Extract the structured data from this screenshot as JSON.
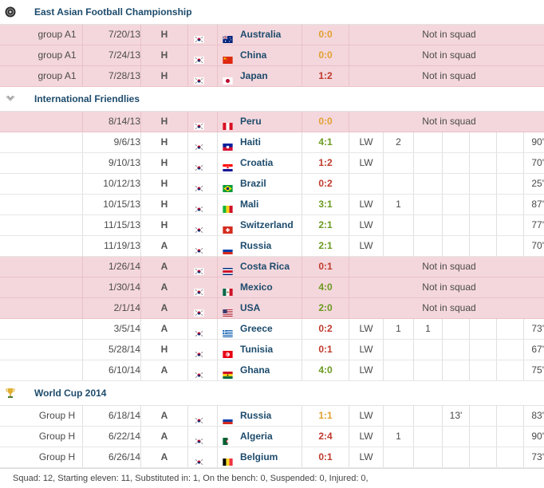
{
  "sections": [
    {
      "title": "East Asian Football Championship",
      "icon": "eaff-logo-icon",
      "rows": [
        {
          "round": "group A1",
          "date": "7/20/13",
          "ha": "H",
          "opp": "Australia",
          "opp_flag": "australia",
          "result": "0:0",
          "res_color": "o",
          "status": "Not in squad"
        },
        {
          "round": "group A1",
          "date": "7/24/13",
          "ha": "H",
          "opp": "China",
          "opp_flag": "china",
          "result": "0:0",
          "res_color": "o",
          "status": "Not in squad"
        },
        {
          "round": "group A1",
          "date": "7/28/13",
          "ha": "H",
          "opp": "Japan",
          "opp_flag": "japan",
          "result": "1:2",
          "res_color": "r",
          "status": "Not in squad"
        }
      ]
    },
    {
      "title": "International Friendlies",
      "icon": "wings-icon",
      "rows": [
        {
          "round": "",
          "date": "8/14/13",
          "ha": "H",
          "opp": "Peru",
          "opp_flag": "peru",
          "result": "0:0",
          "res_color": "o",
          "status": "Not in squad"
        },
        {
          "round": "",
          "date": "9/6/13",
          "ha": "H",
          "opp": "Haiti",
          "opp_flag": "haiti",
          "result": "4:1",
          "res_color": "g",
          "pos": "LW",
          "goals": "2",
          "assists": "",
          "yellow": "",
          "minutes": "90'"
        },
        {
          "round": "",
          "date": "9/10/13",
          "ha": "H",
          "opp": "Croatia",
          "opp_flag": "croatia",
          "result": "1:2",
          "res_color": "r",
          "pos": "LW",
          "goals": "",
          "assists": "",
          "yellow": "",
          "minutes": "70'"
        },
        {
          "round": "",
          "date": "10/12/13",
          "ha": "H",
          "opp": "Brazil",
          "opp_flag": "brazil",
          "result": "0:2",
          "res_color": "r",
          "pos": "",
          "goals": "",
          "assists": "",
          "yellow": "",
          "minutes": "25'"
        },
        {
          "round": "",
          "date": "10/15/13",
          "ha": "H",
          "opp": "Mali",
          "opp_flag": "mali",
          "result": "3:1",
          "res_color": "g",
          "pos": "LW",
          "goals": "1",
          "assists": "",
          "yellow": "",
          "minutes": "87'"
        },
        {
          "round": "",
          "date": "11/15/13",
          "ha": "H",
          "opp": "Switzerland",
          "opp_flag": "switzerland",
          "result": "2:1",
          "res_color": "g",
          "pos": "LW",
          "goals": "",
          "assists": "",
          "yellow": "",
          "minutes": "77'"
        },
        {
          "round": "",
          "date": "11/19/13",
          "ha": "A",
          "opp": "Russia",
          "opp_flag": "russia",
          "result": "2:1",
          "res_color": "g",
          "pos": "LW",
          "goals": "",
          "assists": "",
          "yellow": "",
          "minutes": "70'"
        },
        {
          "round": "",
          "date": "1/26/14",
          "ha": "A",
          "opp": "Costa Rica",
          "opp_flag": "costarica",
          "result": "0:1",
          "res_color": "r",
          "status": "Not in squad"
        },
        {
          "round": "",
          "date": "1/30/14",
          "ha": "A",
          "opp": "Mexico",
          "opp_flag": "mexico",
          "result": "4:0",
          "res_color": "g",
          "status": "Not in squad"
        },
        {
          "round": "",
          "date": "2/1/14",
          "ha": "A",
          "opp": "USA",
          "opp_flag": "usa",
          "result": "2:0",
          "res_color": "g",
          "status": "Not in squad"
        },
        {
          "round": "",
          "date": "3/5/14",
          "ha": "A",
          "opp": "Greece",
          "opp_flag": "greece",
          "result": "0:2",
          "res_color": "r",
          "pos": "LW",
          "goals": "1",
          "assists": "1",
          "yellow": "",
          "minutes": "73'"
        },
        {
          "round": "",
          "date": "5/28/14",
          "ha": "H",
          "opp": "Tunisia",
          "opp_flag": "tunisia",
          "result": "0:1",
          "res_color": "r",
          "pos": "LW",
          "goals": "",
          "assists": "",
          "yellow": "",
          "minutes": "67'"
        },
        {
          "round": "",
          "date": "6/10/14",
          "ha": "A",
          "opp": "Ghana",
          "opp_flag": "ghana",
          "result": "4:0",
          "res_color": "g",
          "pos": "LW",
          "goals": "",
          "assists": "",
          "yellow": "",
          "minutes": "75'"
        }
      ]
    },
    {
      "title": "World Cup 2014",
      "icon": "trophy-icon",
      "rows": [
        {
          "round": "Group H",
          "date": "6/18/14",
          "ha": "A",
          "opp": "Russia",
          "opp_flag": "russia",
          "result": "1:1",
          "res_color": "o",
          "pos": "LW",
          "goals": "",
          "assists": "",
          "yellow": "13'",
          "minutes": "83'"
        },
        {
          "round": "Group H",
          "date": "6/22/14",
          "ha": "A",
          "opp": "Algeria",
          "opp_flag": "algeria",
          "result": "2:4",
          "res_color": "r",
          "pos": "LW",
          "goals": "1",
          "assists": "",
          "yellow": "",
          "minutes": "90'"
        },
        {
          "round": "Group H",
          "date": "6/26/14",
          "ha": "A",
          "opp": "Belgium",
          "opp_flag": "belgium",
          "result": "0:1",
          "res_color": "r",
          "pos": "LW",
          "goals": "",
          "assists": "",
          "yellow": "",
          "minutes": "73'"
        }
      ]
    }
  ],
  "footer": "Squad: 12, Starting eleven: 11, Substituted in: 1, On the bench: 0, Suspended: 0, Injured: 0,"
}
